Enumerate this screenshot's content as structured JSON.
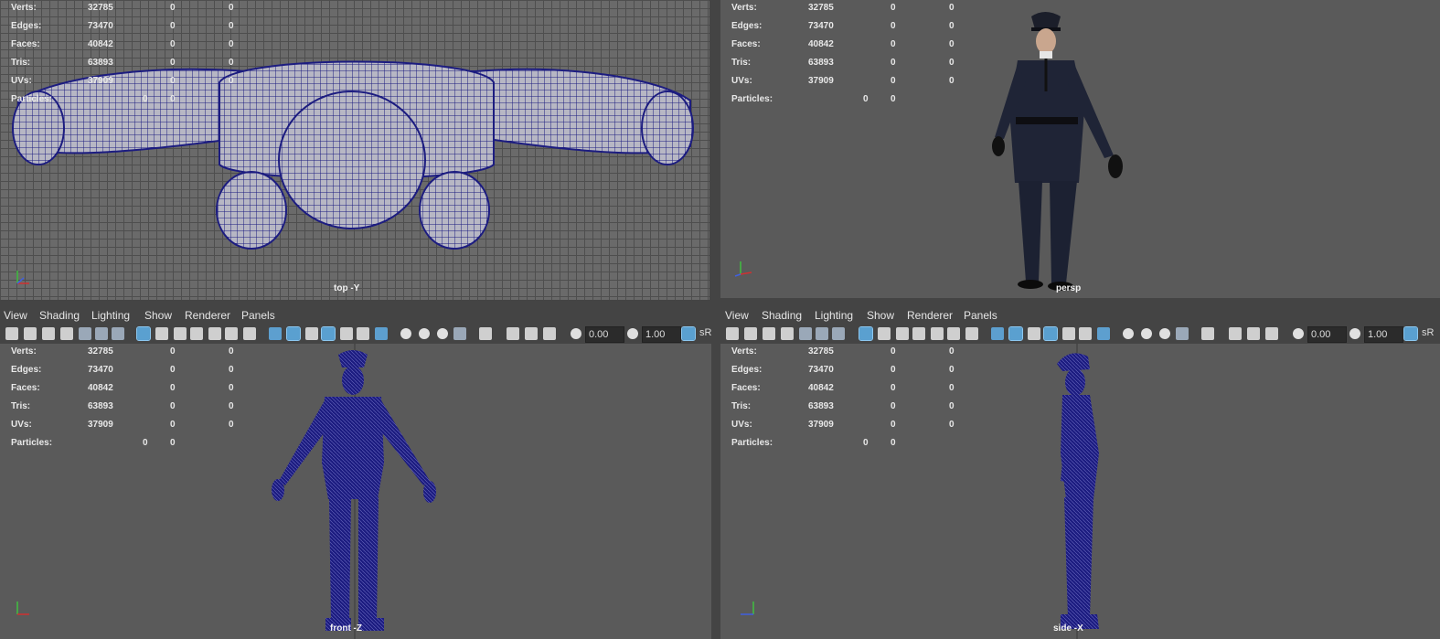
{
  "stats": {
    "verts_label": "Verts:",
    "edges_label": "Edges:",
    "faces_label": "Faces:",
    "tris_label": "Tris:",
    "uvs_label": "UVs:",
    "particles_label": "Particles:",
    "verts": [
      "32785",
      "0",
      "0"
    ],
    "edges": [
      "73470",
      "0",
      "0"
    ],
    "faces": [
      "40842",
      "0",
      "0"
    ],
    "tris": [
      "63893",
      "0",
      "0"
    ],
    "uvs": [
      "37909",
      "0",
      "0"
    ],
    "particles": [
      "0",
      "0"
    ]
  },
  "viewports": {
    "top": "top -Y",
    "persp": "persp",
    "front": "front -Z",
    "side": "side -X"
  },
  "menu": {
    "view": "View",
    "shading": "Shading",
    "lighting": "Lighting",
    "show": "Show",
    "renderer": "Renderer",
    "panels": "Panels"
  },
  "toolbar": {
    "exposure": "0.00",
    "gamma": "1.00",
    "colorspace": "sR"
  },
  "colors": {
    "wire": "#1c1c80",
    "viewport_bg": "#5a5a5a",
    "panel_bg": "#444444",
    "selected_icon": "#5aa0d0"
  }
}
